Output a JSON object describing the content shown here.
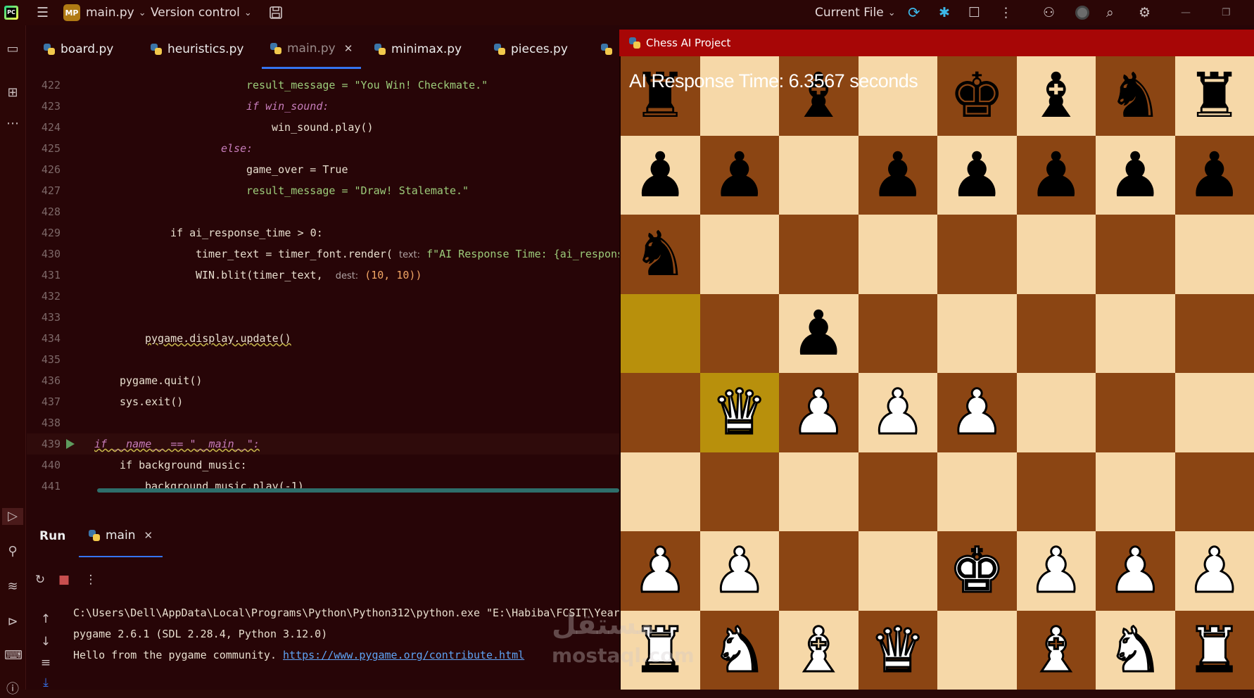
{
  "titlebar": {
    "app_logo": "PC",
    "project_badge": "MP",
    "project_name": "main.py",
    "vcs_label": "Version control",
    "run_config": "Current File"
  },
  "tabs": [
    {
      "label": "board.py"
    },
    {
      "label": "heuristics.py"
    },
    {
      "label": "main.py"
    },
    {
      "label": "minimax.py"
    },
    {
      "label": "pieces.py"
    }
  ],
  "editor": {
    "lines": [
      {
        "num": "422",
        "code": "result_message = \"You Win! Checkmate.\""
      },
      {
        "num": "423",
        "code": "if win_sound:"
      },
      {
        "num": "424",
        "code": "win_sound.play()"
      },
      {
        "num": "425",
        "code": "else:"
      },
      {
        "num": "426",
        "code": "game_over = True"
      },
      {
        "num": "427",
        "code": "result_message = \"Draw! Stalemate.\""
      },
      {
        "num": "428",
        "code": ""
      },
      {
        "num": "429",
        "code": "if ai_response_time > 0:"
      },
      {
        "num": "430",
        "code": "timer_text = timer_font.render(",
        "hint": "text:",
        "tail": "f\"AI Response Time: {ai_respons"
      },
      {
        "num": "431",
        "code": "WIN.blit(timer_text,",
        "hint": "dest:",
        "tail": "(10, 10))"
      },
      {
        "num": "432",
        "code": ""
      },
      {
        "num": "433",
        "code": ""
      },
      {
        "num": "434",
        "code": "pygame.display.update()"
      },
      {
        "num": "435",
        "code": ""
      },
      {
        "num": "436",
        "code": "pygame.quit()"
      },
      {
        "num": "437",
        "code": "sys.exit()"
      },
      {
        "num": "438",
        "code": ""
      },
      {
        "num": "439",
        "code": "if __name__ == \"__main__\":"
      },
      {
        "num": "440",
        "code": "if background_music:"
      },
      {
        "num": "441",
        "code": "background_music.play(-1)"
      }
    ]
  },
  "runpanel": {
    "tab_run": "Run",
    "tab_main": "main",
    "console": [
      "C:\\Users\\Dell\\AppData\\Local\\Programs\\Python\\Python312\\python.exe \"E:\\Habiba\\FCSIT\\Year",
      "pygame 2.6.1 (SDL 2.28.4, Python 3.12.0)",
      "Hello from the pygame community. "
    ],
    "console_link": "https://www.pygame.org/contribute.html"
  },
  "chess": {
    "window_title": "Chess AI Project",
    "ai_response": "AI Response Time: 6.3567 seconds",
    "board": [
      [
        "br",
        "",
        "bb",
        "",
        "bk",
        "bb",
        "bn",
        "br"
      ],
      [
        "bp",
        "bp",
        "",
        "bp",
        "bp",
        "bp",
        "bp",
        "bp"
      ],
      [
        "bn",
        "",
        "",
        "",
        "",
        "",
        "",
        ""
      ],
      [
        "",
        "",
        "bp",
        "",
        "",
        "",
        "",
        ""
      ],
      [
        "",
        "wq",
        "wp",
        "wp",
        "wp",
        "",
        "",
        ""
      ],
      [
        "",
        "",
        "",
        "",
        "",
        "",
        "",
        ""
      ],
      [
        "wp",
        "wp",
        "",
        "",
        "wk",
        "wp",
        "wp",
        "wp"
      ],
      [
        "wr",
        "wn",
        "wb",
        "wq",
        "",
        "wb",
        "wn",
        "wr"
      ]
    ],
    "highlights": [
      "3-0",
      "4-1"
    ]
  },
  "watermark": "مستقل\nmostaql.com"
}
